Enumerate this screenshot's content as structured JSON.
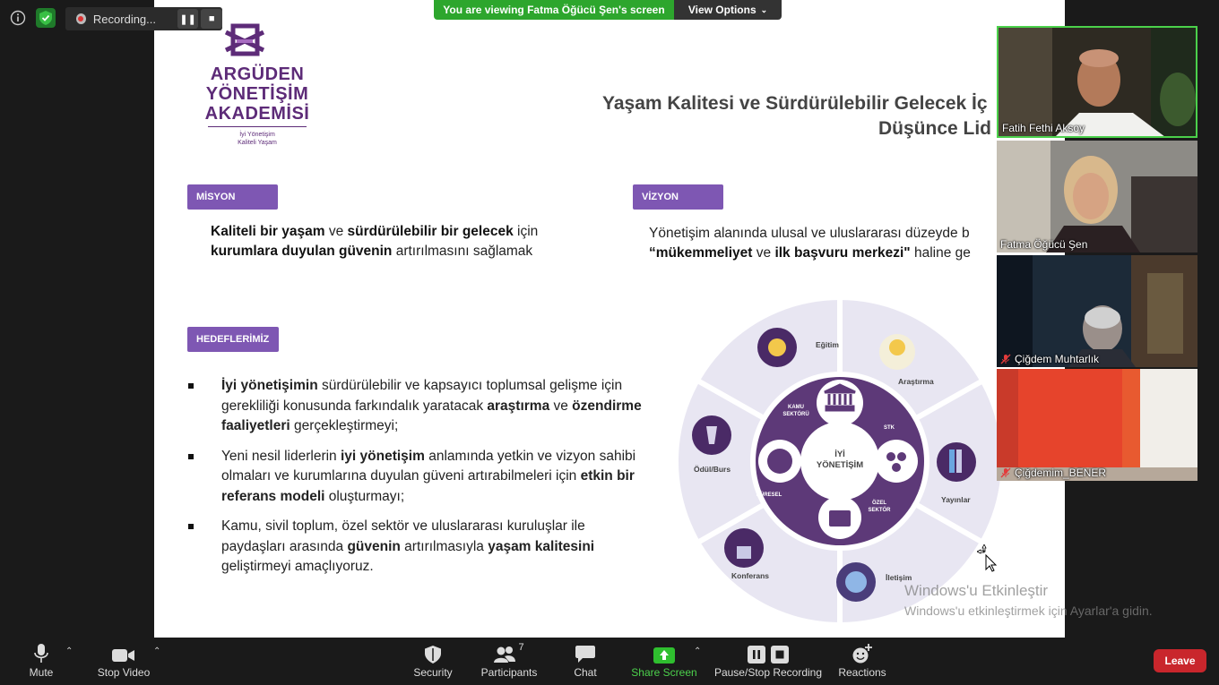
{
  "meeting": {
    "recording_label": "Recording...",
    "banner_text": "You are viewing Fatma Öğücü Şen's screen",
    "view_options_label": "View Options"
  },
  "slide": {
    "logo": {
      "line1": "ARGÜDEN",
      "line2": "YÖNETİŞİM",
      "line3": "AKADEMİSİ",
      "sub1": "İyi Yönetişim",
      "sub2": "Kaliteli Yaşam"
    },
    "title_line1": "Yaşam Kalitesi ve Sürdürülebilir Gelecek İç",
    "title_line2": "Düşünce Lid",
    "misyon": {
      "tag": "MİSYON",
      "t1": "Kaliteli bir yaşam",
      "t2": " ve ",
      "t3": "sürdürülebilir  bir gelecek",
      "t4": " için",
      "t5": "kurumlara duyulan güvenin",
      "t6": " artırılmasını sağlamak"
    },
    "vizyon": {
      "tag": "VİZYON",
      "t1": "Yönetişim alanında ulusal ve uluslararası düzeyde b",
      "t2": "“mükemmeliyet",
      "t3": " ve ",
      "t4": "ilk başvuru merkezi\"",
      "t5": " haline ge"
    },
    "hedef": {
      "tag": "HEDEFLERİMİZ",
      "b1": [
        "İyi yönetişimin",
        " sürdürülebilir ve kapsayıcı toplumsal gelişme için gerekliliği konusunda farkındalık yaratacak ",
        "araştırma",
        " ve ",
        "özendirme faaliyetleri",
        " gerçekleştirmeyi;"
      ],
      "b2": [
        "Yeni nesil liderlerin ",
        "iyi yönetişim",
        " anlamında yetkin ve vizyon sahibi olmaları ve kurumlarına duyulan güveni artırabilmeleri için ",
        "etkin bir referans modeli",
        " oluşturmayı;"
      ],
      "b3": [
        "Kamu, sivil toplum, özel sektör ve uluslararası kuruluşlar ile paydaşları arasında ",
        "güvenin",
        " artırılmasıyla ",
        "yaşam kalitesini",
        " geliştirmeyi amaçlıyoruz."
      ]
    },
    "wheel": {
      "center1": "İYİ",
      "center2": "YÖNETİŞİM",
      "inner_labels": {
        "kamu1": "KAMU",
        "kamu2": "SEKTÖRÜ",
        "stk": "STK",
        "ozel1": "ÖZEL",
        "ozel2": "SEKTÖR",
        "kuresel": "KÜRESEL"
      },
      "outer_labels": {
        "egitim": "Eğitim",
        "arastirma": "Araştırma",
        "yayinlar": "Yayınlar",
        "iletisim": "İletişim",
        "konferans": "Konferans",
        "odul": "Ödül/Burs"
      }
    }
  },
  "watermark": {
    "line1": "Windows'u Etkinleştir",
    "line2": "Windows'u etkinleştirmek için Ayarlar'a gidin."
  },
  "participants": [
    {
      "name": "Fatih Fethi Aksoy",
      "muted": false
    },
    {
      "name": "Fatma Öğücü Şen",
      "muted": false
    },
    {
      "name": "Çiğdem Muhtarlık",
      "muted": true
    },
    {
      "name": "Çiğdemim_BENER",
      "muted": true
    }
  ],
  "toolbar": {
    "mute": "Mute",
    "stop_video": "Stop Video",
    "security": "Security",
    "participants": "Participants",
    "participants_count": "7",
    "chat": "Chat",
    "share_screen": "Share Screen",
    "pause_stop_recording": "Pause/Stop Recording",
    "reactions": "Reactions",
    "leave": "Leave"
  },
  "colors": {
    "accent_green": "#2da62d",
    "purple_tag": "#7e57b3",
    "logo_purple": "#5d2b78",
    "leave_red": "#c9262c"
  }
}
